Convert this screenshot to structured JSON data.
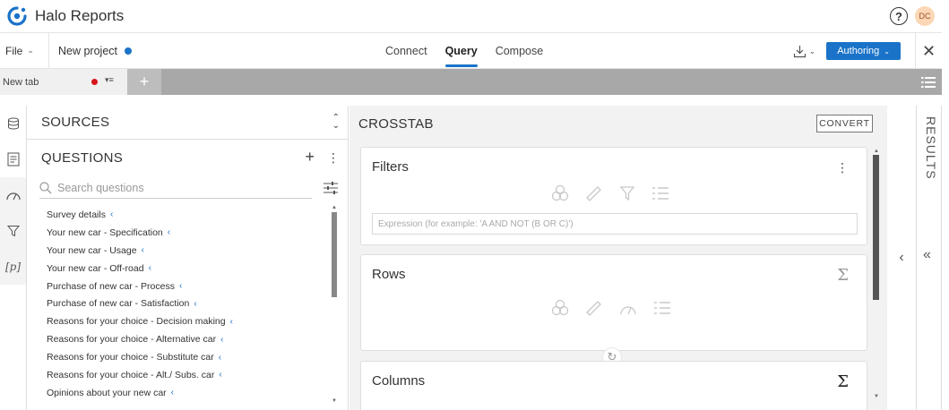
{
  "app": {
    "title": "Halo Reports",
    "user_initials": "DC",
    "help_symbol": "?",
    "brand_color": "#1a73c8"
  },
  "nav": {
    "file_label": "File",
    "project_name": "New project",
    "tabs": [
      {
        "label": "Connect"
      },
      {
        "label": "Query",
        "active": true
      },
      {
        "label": "Compose"
      }
    ],
    "mode_label": "Authoring"
  },
  "doc_tabs": {
    "tab_label": "New tab",
    "add_symbol": "+"
  },
  "sources": {
    "title": "SOURCES"
  },
  "questions": {
    "title": "QUESTIONS",
    "search_placeholder": "Search questions",
    "items": [
      "Survey details",
      "Your new car - Specification",
      "Your new car - Usage",
      "Your new car - Off-road",
      "Purchase of new car - Process",
      "Purchase of new car - Satisfaction",
      "Reasons for your choice - Decision making",
      "Reasons for your choice - Alternative car",
      "Reasons for your choice - Substitute car",
      "Reasons for your choice - Alt./ Subs. car",
      "Opinions about your new car"
    ]
  },
  "crosstab": {
    "title": "CROSSTAB",
    "convert_label": "CONVERT",
    "filters_title": "Filters",
    "expression_placeholder": "Expression (for example: 'A AND NOT (B OR C)')",
    "rows_title": "Rows",
    "columns_title": "Columns",
    "sigma_symbol": "Σ"
  },
  "results": {
    "label": "RESULTS"
  },
  "icons": {
    "logo": "halo-logo-icon",
    "help": "help-icon",
    "download": "download-icon",
    "close": "close-icon",
    "list_view": "list-view-icon",
    "sources_rail": "database-icon",
    "questions_rail": "questions-icon",
    "gauge_rail": "gauge-icon",
    "filter_rail": "filter-icon",
    "param_rail": "parameter-icon"
  }
}
